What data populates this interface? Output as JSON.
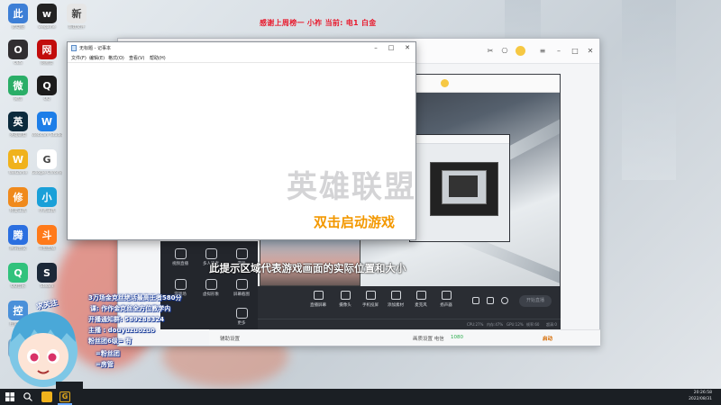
{
  "banner": {
    "text": "感谢上周榜一 小祚  当前: 电1 白金"
  },
  "desktop_icons": [
    {
      "label": "此电脑",
      "icon": "computer-icon",
      "color": "#3d7fd6"
    },
    {
      "label": "wegame",
      "icon": "wegame-icon",
      "color": "#222222"
    },
    {
      "label": "新建文件",
      "icon": "file-icon",
      "color": "#e6e6e6"
    },
    {
      "label": "OBS",
      "icon": "obs-icon",
      "color": "#302e31"
    },
    {
      "label": "网易云",
      "icon": "netease-icon",
      "color": "#c20c0c"
    },
    {
      "label": "微信",
      "icon": "wechat-icon",
      "color": "#2aae67"
    },
    {
      "label": "QQ",
      "icon": "qq-icon",
      "color": "#1c1c1c"
    },
    {
      "label": "英雄联盟",
      "icon": "lol-icon",
      "color": "#0b2a3c"
    },
    {
      "label": "Webcam Studio",
      "icon": "webcam-icon",
      "color": "#1d7ee8"
    },
    {
      "label": "WeGame",
      "icon": "wegame-owl-icon",
      "color": "#f0b21c"
    },
    {
      "label": "Google Chrome",
      "icon": "chrome-icon",
      "color": "#ffffff"
    },
    {
      "label": "修复工具",
      "icon": "tool-icon",
      "color": "#f08a1c"
    },
    {
      "label": "小丸工具",
      "icon": "converter-icon",
      "color": "#1aa0d8"
    },
    {
      "label": "腾讯会议",
      "icon": "meeting-icon",
      "color": "#2b6fe0"
    },
    {
      "label": "斗鱼直播",
      "icon": "douyu-icon",
      "color": "#ff7a1a"
    },
    {
      "label": "QQ音乐",
      "icon": "qqmusic-icon",
      "color": "#31c27c"
    },
    {
      "label": "Steam",
      "icon": "steam-icon",
      "color": "#1b2838"
    },
    {
      "label": "控制面板",
      "icon": "panel-icon",
      "color": "#4a90d9"
    },
    {
      "label": "回收站",
      "icon": "recycle-icon",
      "color": "#7fa8c9"
    }
  ],
  "notepad": {
    "title": "无标题 - 记事本",
    "menu": [
      "文件(F)",
      "编辑(E)",
      "格式(O)",
      "查看(V)",
      "帮助(H)"
    ]
  },
  "stream_app": {
    "side_items": [
      "视频直播",
      "多人连麦",
      "游戏",
      "游戏场",
      "虚拟形象",
      "屏幕截图",
      "更多"
    ],
    "toolbar": [
      "直播屏幕",
      "摄像头",
      "手机投屏",
      "添加素材",
      "麦克风",
      "扬声器"
    ],
    "start_label": "开始直播",
    "status": [
      "CPU:27%",
      "内存:47%",
      "GPU:12%",
      "帧率:60",
      "超清:0"
    ],
    "bottom": [
      "辅助设置",
      "画质设置 电信",
      "1080",
      "启动"
    ]
  },
  "overlay": {
    "watermark": "英雄联盟",
    "double_click": "双击启动游戏",
    "hint": "此提示区域代表游戏画面的实际位置和大小"
  },
  "stream_info": {
    "follow": "求关注",
    "lines": [
      "3万场金克丝绝活最高王者580分",
      "课: 作作金克丝全方位教学内",
      "开播通知群: 589288324",
      "主播  : douyuzuozuo",
      "粉丝团6级=  有",
      "=粉丝团",
      "=房管"
    ]
  },
  "taskbar": {
    "time": "20:26:58",
    "date": "2022/08/31"
  }
}
